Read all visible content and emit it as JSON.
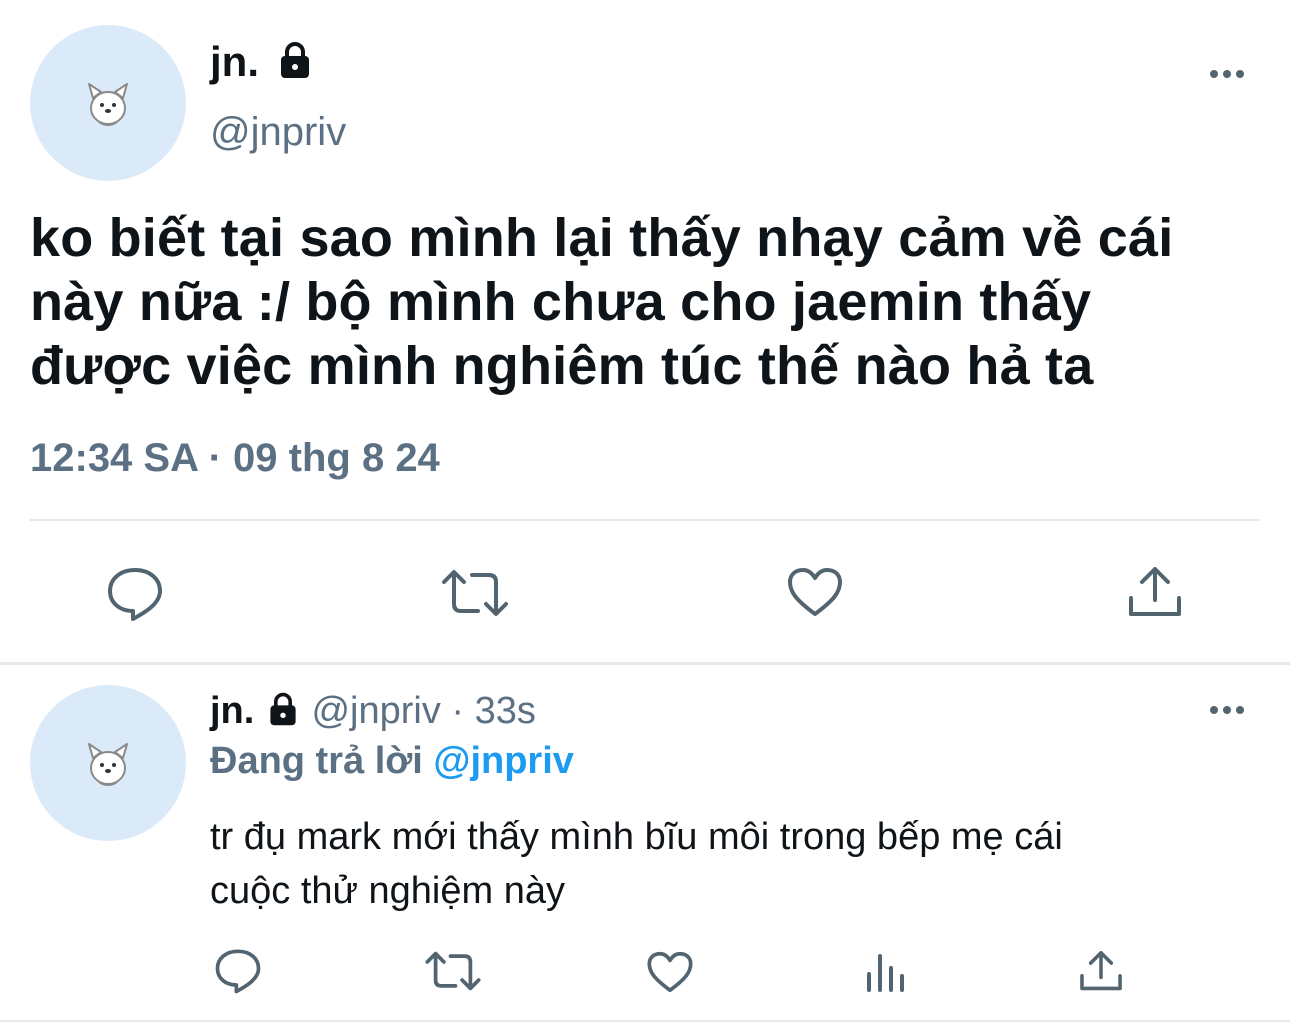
{
  "main_tweet": {
    "display_name": "jn.",
    "handle": "@jnpriv",
    "text_lines": [
      "ko biết tại sao mình lại thấy nhạy cảm về cái",
      "này nữa :/ bộ mình chưa cho jaemin thấy",
      "được việc mình nghiêm túc thế nào hả ta"
    ],
    "timestamp": "12:34 SA · 09 thg 8 24",
    "icons": [
      "comment-icon",
      "retweet-icon",
      "heart-icon",
      "share-icon"
    ]
  },
  "reply_tweet": {
    "display_name": "jn.",
    "handle_time": "@jnpriv · 33s",
    "replying_prefix": "Đang trả lời",
    "replying_handle": "@jnpriv",
    "text_lines": [
      "tr đụ mark mới thấy mình bĩu môi trong bếp mẹ cái",
      "cuộc thử nghiệm này"
    ],
    "icons": [
      "comment-icon",
      "retweet-icon",
      "heart-icon",
      "analytics-icon",
      "share-icon"
    ]
  },
  "colors": {
    "avatar_bg": "#dbeaf8",
    "secondary_text": "#5b7083",
    "mention": "#1d9bf0",
    "icon": "#536471"
  }
}
